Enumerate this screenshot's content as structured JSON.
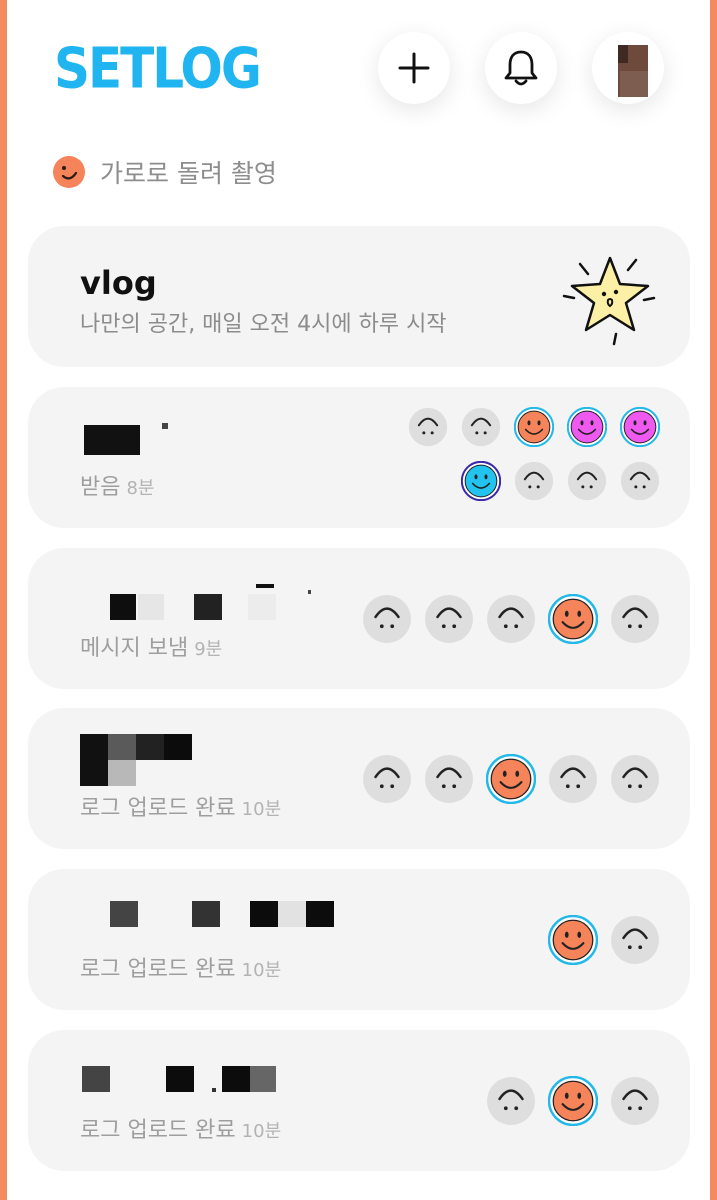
{
  "app": {
    "logo_text": "SETLOG"
  },
  "header": {
    "add_icon": "plus-icon",
    "notification_icon": "bell-icon",
    "avatar_icon": "profile-avatar"
  },
  "hint": {
    "icon": "rotate-smile-icon",
    "text": "가로로 돌려 촬영"
  },
  "vlog_card": {
    "title": "vlog",
    "description": "나만의 공간, 매일 오전 4시에 하루 시작",
    "icon": "star-character-icon"
  },
  "friends": [
    {
      "status": "받음",
      "time": "8분",
      "faces": [
        "inactive",
        "inactive",
        "orange",
        "magenta",
        "magenta",
        "blue",
        "inactive",
        "inactive",
        "inactive"
      ]
    },
    {
      "status": "메시지 보냄",
      "time": "9분",
      "faces": [
        "inactive",
        "inactive",
        "inactive",
        "orange",
        "inactive"
      ]
    },
    {
      "status": "로그 업로드 완료",
      "time": "10분",
      "faces": [
        "inactive",
        "inactive",
        "orange",
        "inactive",
        "inactive"
      ]
    },
    {
      "status": "로그 업로드 완료",
      "time": "10분",
      "faces": [
        "orange",
        "inactive"
      ]
    },
    {
      "status": "로그 업로드 완료",
      "time": "10분",
      "faces": [
        "inactive",
        "orange",
        "inactive"
      ]
    }
  ],
  "colors": {
    "accent_frame": "#f58a5e",
    "logo": "#20b5f0",
    "face_orange": "#f5845a",
    "face_magenta": "#ee5af0",
    "face_blue": "#22c3ee",
    "face_ring": "#22b8e8",
    "face_inactive": "#dedede"
  }
}
